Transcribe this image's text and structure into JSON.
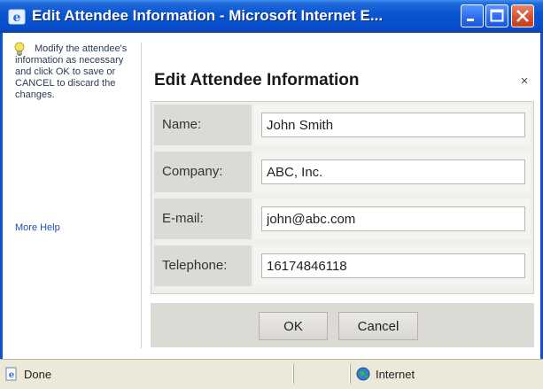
{
  "window": {
    "title": "Edit Attendee Information - Microsoft Internet E...",
    "icon": "ie-icon"
  },
  "help": {
    "text": "Modify the attendee's information as necessary and click OK to save or CANCEL to discard the changes.",
    "more_help_label": "More Help",
    "icon": "lightbulb-icon"
  },
  "dialog": {
    "title": "Edit Attendee Information",
    "close_label": "×",
    "fields": [
      {
        "label": "Name:",
        "value": "John Smith"
      },
      {
        "label": "Company:",
        "value": "ABC, Inc."
      },
      {
        "label": "E-mail:",
        "value": "john@abc.com"
      },
      {
        "label": "Telephone:",
        "value": "16174846118"
      }
    ],
    "ok_label": "OK",
    "cancel_label": "Cancel"
  },
  "status": {
    "left": "Done",
    "zone": "Internet"
  },
  "colors": {
    "titlebar": "#0a54d2",
    "link": "#1a4fb3",
    "label_cell": "#dcdad4",
    "statusbar": "#ece9d8"
  }
}
